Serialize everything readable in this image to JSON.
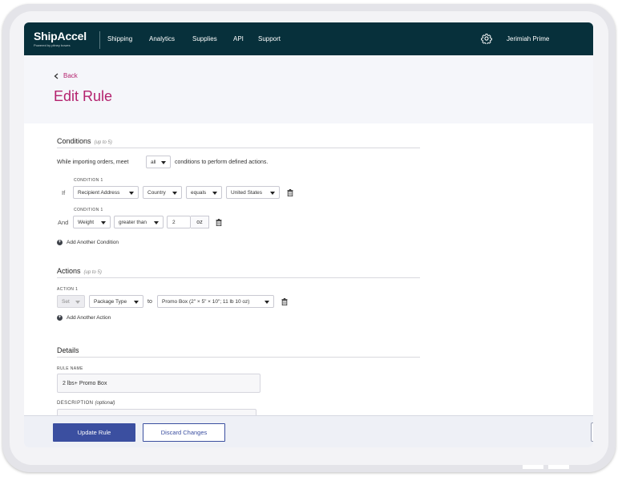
{
  "nav": {
    "brand": "ShipAccel",
    "brand_sub": "Powered by pitney bowes",
    "items": [
      "Shipping",
      "Analytics",
      "Supplies",
      "API",
      "Support"
    ],
    "user_name": "Jerimiah Prime"
  },
  "header": {
    "back_label": "Back",
    "title": "Edit Rule"
  },
  "conditions": {
    "heading": "Conditions",
    "limit_note": "(up to 5)",
    "intro_prefix": "While importing orders, meet",
    "match_value": "all",
    "intro_suffix": "conditions to perform defined actions.",
    "rows": [
      {
        "connector": "If",
        "caption": "CONDITION 1",
        "field": "Recipient Address",
        "subfield": "Country",
        "operator": "equals",
        "value": "United States"
      },
      {
        "connector": "And",
        "caption": "CONDITION 1",
        "field": "Weight",
        "operator": "greater than",
        "value": "2",
        "unit": "oz"
      }
    ],
    "add_label": "Add Another Condition"
  },
  "actions": {
    "heading": "Actions",
    "limit_note": "(up to 5)",
    "caption": "ACTION 1",
    "verb": "Set",
    "target": "Package Type",
    "connector": "to",
    "value": "Promo Box (2\" × 5\" × 10\"; 11 lb 10 oz)",
    "add_label": "Add Another Action"
  },
  "details": {
    "heading": "Details",
    "rule_name_label": "RULE NAME",
    "rule_name_value": "2 lbs+ Promo Box",
    "description_label": "DESCRIPTION",
    "description_optional": "(optional)",
    "description_value": ""
  },
  "footer": {
    "update_label": "Update Rule",
    "discard_label": "Discard Changes"
  },
  "colors": {
    "nav_bg": "#07303b",
    "accent_magenta": "#b4226e",
    "primary_blue": "#3b4fa0"
  }
}
